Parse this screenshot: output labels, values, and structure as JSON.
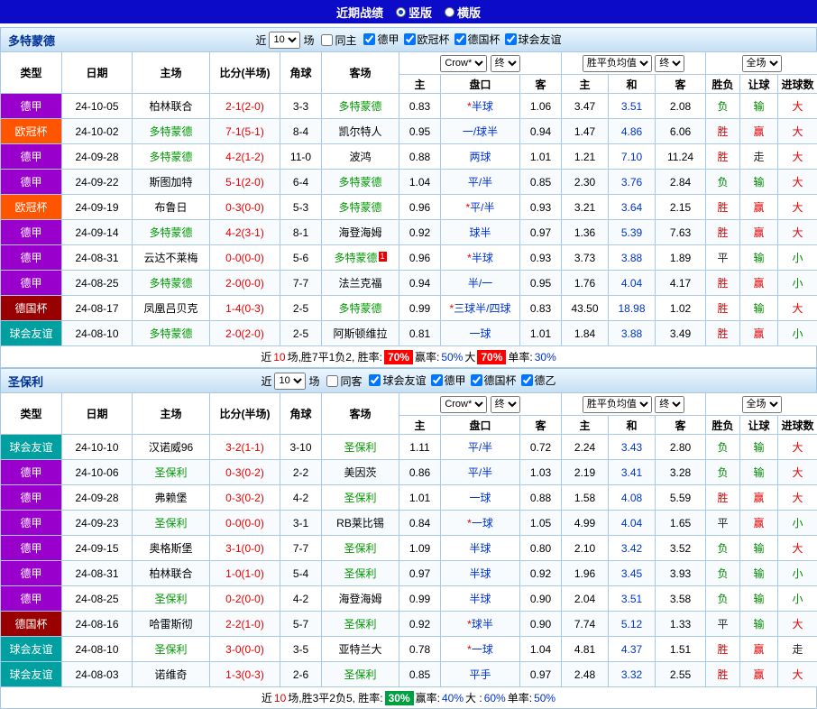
{
  "colors": {
    "topbar_bg": "#0b0bc8",
    "section_header_border": "#9dc3e6",
    "grid_border": "#a9c9e4",
    "score": "#e60000",
    "tracked_team": "#009900",
    "handicap": "#0033cc",
    "star": "#e60000",
    "avg_draw": "#0033cc",
    "badge_red": "#ff0000",
    "badge_green": "#00a040",
    "type_colors": {
      "德甲": "#9900cc",
      "欧冠杯": "#ff5500",
      "德国杯": "#990000",
      "球会友谊": "#00a0a0"
    },
    "result_colors": {
      "胜": "#e60000",
      "负": "#008800",
      "平": "#222222",
      "赢": "#e60000",
      "输": "#008800",
      "走": "#222222",
      "大": "#e60000",
      "小": "#008800"
    }
  },
  "topbar": {
    "title": "近期战绩",
    "options": [
      {
        "label": "竖版",
        "selected": true
      },
      {
        "label": "横版",
        "selected": false
      }
    ]
  },
  "table_head": {
    "col_type": "类型",
    "col_date": "日期",
    "col_home": "主场",
    "col_score": "比分(半场)",
    "col_corner": "角球",
    "col_away": "客场",
    "col_h": "主",
    "col_handicap": "盘口",
    "col_a": "客",
    "col_w": "主",
    "col_d": "和",
    "col_l": "客",
    "col_res": "胜负",
    "col_han": "让球",
    "col_goal": "进球数"
  },
  "sections": [
    {
      "team": "多特蒙德",
      "filter": {
        "near": "近",
        "count": "10",
        "unit": "场",
        "same_label": "同主",
        "same_checked": false,
        "leagues": [
          {
            "label": "德甲",
            "checked": true
          },
          {
            "label": "欧冠杯",
            "checked": true
          },
          {
            "label": "德国杯",
            "checked": true
          },
          {
            "label": "球会友谊",
            "checked": true
          }
        ]
      },
      "selects": {
        "company": "Crow*",
        "final_a": "终",
        "avg": "胜平负均值",
        "final_b": "终",
        "scope": "全场"
      },
      "rows": [
        {
          "type": "德甲",
          "date": "24-10-05",
          "home": "柏林联合",
          "score": "2-1(2-0)",
          "corner": "3-3",
          "away": "多特蒙德",
          "tracked": "away",
          "red_card": "",
          "o_home": "0.83",
          "handicap": "*半球",
          "o_away": "1.06",
          "avg_w": "3.47",
          "avg_d": "3.51",
          "avg_l": "2.08",
          "res": "负",
          "han": "输",
          "goal": "大"
        },
        {
          "type": "欧冠杯",
          "date": "24-10-02",
          "home": "多特蒙德",
          "score": "7-1(5-1)",
          "corner": "8-4",
          "away": "凯尔特人",
          "tracked": "home",
          "red_card": "",
          "o_home": "0.95",
          "handicap": "一/球半",
          "o_away": "0.94",
          "avg_w": "1.47",
          "avg_d": "4.86",
          "avg_l": "6.06",
          "res": "胜",
          "han": "赢",
          "goal": "大"
        },
        {
          "type": "德甲",
          "date": "24-09-28",
          "home": "多特蒙德",
          "score": "4-2(1-2)",
          "corner": "11-0",
          "away": "波鸿",
          "tracked": "home",
          "red_card": "",
          "o_home": "0.88",
          "handicap": "两球",
          "o_away": "1.01",
          "avg_w": "1.21",
          "avg_d": "7.10",
          "avg_l": "11.24",
          "res": "胜",
          "han": "走",
          "goal": "大"
        },
        {
          "type": "德甲",
          "date": "24-09-22",
          "home": "斯图加特",
          "score": "5-1(2-0)",
          "corner": "6-4",
          "away": "多特蒙德",
          "tracked": "away",
          "red_card": "",
          "o_home": "1.04",
          "handicap": "平/半",
          "o_away": "0.85",
          "avg_w": "2.30",
          "avg_d": "3.76",
          "avg_l": "2.84",
          "res": "负",
          "han": "输",
          "goal": "大"
        },
        {
          "type": "欧冠杯",
          "date": "24-09-19",
          "home": "布鲁日",
          "score": "0-3(0-0)",
          "corner": "5-3",
          "away": "多特蒙德",
          "tracked": "away",
          "red_card": "",
          "o_home": "0.96",
          "handicap": "*平/半",
          "o_away": "0.93",
          "avg_w": "3.21",
          "avg_d": "3.64",
          "avg_l": "2.15",
          "res": "胜",
          "han": "赢",
          "goal": "大"
        },
        {
          "type": "德甲",
          "date": "24-09-14",
          "home": "多特蒙德",
          "score": "4-2(3-1)",
          "corner": "8-1",
          "away": "海登海姆",
          "tracked": "home",
          "red_card": "",
          "o_home": "0.92",
          "handicap": "球半",
          "o_away": "0.97",
          "avg_w": "1.36",
          "avg_d": "5.39",
          "avg_l": "7.63",
          "res": "胜",
          "han": "赢",
          "goal": "大"
        },
        {
          "type": "德甲",
          "date": "24-08-31",
          "home": "云达不莱梅",
          "score": "0-0(0-0)",
          "corner": "5-6",
          "away": "多特蒙德",
          "tracked": "away",
          "red_card": "1",
          "o_home": "0.96",
          "handicap": "*半球",
          "o_away": "0.93",
          "avg_w": "3.73",
          "avg_d": "3.88",
          "avg_l": "1.89",
          "res": "平",
          "han": "输",
          "goal": "小"
        },
        {
          "type": "德甲",
          "date": "24-08-25",
          "home": "多特蒙德",
          "score": "2-0(0-0)",
          "corner": "7-7",
          "away": "法兰克福",
          "tracked": "home",
          "red_card": "",
          "o_home": "0.94",
          "handicap": "半/一",
          "o_away": "0.95",
          "avg_w": "1.76",
          "avg_d": "4.04",
          "avg_l": "4.17",
          "res": "胜",
          "han": "赢",
          "goal": "小"
        },
        {
          "type": "德国杯",
          "date": "24-08-17",
          "home": "凤凰吕贝克",
          "score": "1-4(0-3)",
          "corner": "2-5",
          "away": "多特蒙德",
          "tracked": "away",
          "red_card": "",
          "o_home": "0.99",
          "handicap": "*三球半/四球",
          "o_away": "0.83",
          "avg_w": "43.50",
          "avg_d": "18.98",
          "avg_l": "1.02",
          "res": "胜",
          "han": "输",
          "goal": "大"
        },
        {
          "type": "球会友谊",
          "date": "24-08-10",
          "home": "多特蒙德",
          "score": "2-0(2-0)",
          "corner": "2-5",
          "away": "阿斯顿维拉",
          "tracked": "home",
          "red_card": "",
          "o_home": "0.81",
          "handicap": "一球",
          "o_away": "1.01",
          "avg_w": "1.84",
          "avg_d": "3.88",
          "avg_l": "3.49",
          "res": "胜",
          "han": "赢",
          "goal": "小"
        }
      ],
      "footer": [
        {
          "t": "近",
          "s": "plain"
        },
        {
          "t": "10",
          "s": "red"
        },
        {
          "t": "场,胜7平1负2, 胜率: ",
          "s": "plain"
        },
        {
          "t": "70%",
          "s": "badge-red"
        },
        {
          "t": " 赢率:",
          "s": "plain"
        },
        {
          "t": "50%",
          "s": "blue"
        },
        {
          "t": " 大 ",
          "s": "plain"
        },
        {
          "t": "70%",
          "s": "badge-red"
        },
        {
          "t": " 单率:",
          "s": "plain"
        },
        {
          "t": "30%",
          "s": "blue"
        }
      ]
    },
    {
      "team": "圣保利",
      "filter": {
        "near": "近",
        "count": "10",
        "unit": "场",
        "same_label": "同客",
        "same_checked": false,
        "leagues": [
          {
            "label": "球会友谊",
            "checked": true
          },
          {
            "label": "德甲",
            "checked": true
          },
          {
            "label": "德国杯",
            "checked": true
          },
          {
            "label": "德乙",
            "checked": true
          }
        ]
      },
      "selects": {
        "company": "Crow*",
        "final_a": "终",
        "avg": "胜平负均值",
        "final_b": "终",
        "scope": "全场"
      },
      "rows": [
        {
          "type": "球会友谊",
          "date": "24-10-10",
          "home": "汉诺威96",
          "score": "3-2(1-1)",
          "corner": "3-10",
          "away": "圣保利",
          "tracked": "away",
          "red_card": "",
          "o_home": "1.11",
          "handicap": "平/半",
          "o_away": "0.72",
          "avg_w": "2.24",
          "avg_d": "3.43",
          "avg_l": "2.80",
          "res": "负",
          "han": "输",
          "goal": "大"
        },
        {
          "type": "德甲",
          "date": "24-10-06",
          "home": "圣保利",
          "score": "0-3(0-2)",
          "corner": "2-2",
          "away": "美因茨",
          "tracked": "home",
          "red_card": "",
          "o_home": "0.86",
          "handicap": "平/半",
          "o_away": "1.03",
          "avg_w": "2.19",
          "avg_d": "3.41",
          "avg_l": "3.28",
          "res": "负",
          "han": "输",
          "goal": "大"
        },
        {
          "type": "德甲",
          "date": "24-09-28",
          "home": "弗赖堡",
          "score": "0-3(0-2)",
          "corner": "4-2",
          "away": "圣保利",
          "tracked": "away",
          "red_card": "",
          "o_home": "1.01",
          "handicap": "一球",
          "o_away": "0.88",
          "avg_w": "1.58",
          "avg_d": "4.08",
          "avg_l": "5.59",
          "res": "胜",
          "han": "赢",
          "goal": "大"
        },
        {
          "type": "德甲",
          "date": "24-09-23",
          "home": "圣保利",
          "score": "0-0(0-0)",
          "corner": "3-1",
          "away": "RB莱比锡",
          "tracked": "home",
          "red_card": "",
          "o_home": "0.84",
          "handicap": "*一球",
          "o_away": "1.05",
          "avg_w": "4.99",
          "avg_d": "4.04",
          "avg_l": "1.65",
          "res": "平",
          "han": "赢",
          "goal": "小"
        },
        {
          "type": "德甲",
          "date": "24-09-15",
          "home": "奥格斯堡",
          "score": "3-1(0-0)",
          "corner": "7-7",
          "away": "圣保利",
          "tracked": "away",
          "red_card": "",
          "o_home": "1.09",
          "handicap": "半球",
          "o_away": "0.80",
          "avg_w": "2.10",
          "avg_d": "3.42",
          "avg_l": "3.52",
          "res": "负",
          "han": "输",
          "goal": "大"
        },
        {
          "type": "德甲",
          "date": "24-08-31",
          "home": "柏林联合",
          "score": "1-0(1-0)",
          "corner": "5-4",
          "away": "圣保利",
          "tracked": "away",
          "red_card": "",
          "o_home": "0.97",
          "handicap": "半球",
          "o_away": "0.92",
          "avg_w": "1.96",
          "avg_d": "3.45",
          "avg_l": "3.93",
          "res": "负",
          "han": "输",
          "goal": "小"
        },
        {
          "type": "德甲",
          "date": "24-08-25",
          "home": "圣保利",
          "score": "0-2(0-0)",
          "corner": "4-2",
          "away": "海登海姆",
          "tracked": "home",
          "red_card": "",
          "o_home": "0.99",
          "handicap": "半球",
          "o_away": "0.90",
          "avg_w": "2.04",
          "avg_d": "3.51",
          "avg_l": "3.58",
          "res": "负",
          "han": "输",
          "goal": "小"
        },
        {
          "type": "德国杯",
          "date": "24-08-16",
          "home": "哈雷斯彻",
          "score": "2-2(1-0)",
          "corner": "5-7",
          "away": "圣保利",
          "tracked": "away",
          "red_card": "",
          "o_home": "0.92",
          "handicap": "*球半",
          "o_away": "0.90",
          "avg_w": "7.74",
          "avg_d": "5.12",
          "avg_l": "1.33",
          "res": "平",
          "han": "输",
          "goal": "大"
        },
        {
          "type": "球会友谊",
          "date": "24-08-10",
          "home": "圣保利",
          "score": "3-0(0-0)",
          "corner": "3-5",
          "away": "亚特兰大",
          "tracked": "home",
          "red_card": "",
          "o_home": "0.78",
          "handicap": "*一球",
          "o_away": "1.04",
          "avg_w": "4.81",
          "avg_d": "4.37",
          "avg_l": "1.51",
          "res": "胜",
          "han": "赢",
          "goal": "走"
        },
        {
          "type": "球会友谊",
          "date": "24-08-03",
          "home": "诺维奇",
          "score": "1-3(0-3)",
          "corner": "2-6",
          "away": "圣保利",
          "tracked": "away",
          "red_card": "",
          "o_home": "0.85",
          "handicap": "平手",
          "o_away": "0.97",
          "avg_w": "2.48",
          "avg_d": "3.32",
          "avg_l": "2.55",
          "res": "胜",
          "han": "赢",
          "goal": "大"
        }
      ],
      "footer": [
        {
          "t": "近",
          "s": "plain"
        },
        {
          "t": "10",
          "s": "red"
        },
        {
          "t": "场,胜3平2负5, 胜率: ",
          "s": "plain"
        },
        {
          "t": "30%",
          "s": "badge-green"
        },
        {
          "t": " 赢率:",
          "s": "plain"
        },
        {
          "t": "40%",
          "s": "blue"
        },
        {
          "t": " 大 :",
          "s": "plain"
        },
        {
          "t": "60%",
          "s": "blue"
        },
        {
          "t": " 单率:",
          "s": "plain"
        },
        {
          "t": "50%",
          "s": "blue"
        }
      ]
    }
  ]
}
